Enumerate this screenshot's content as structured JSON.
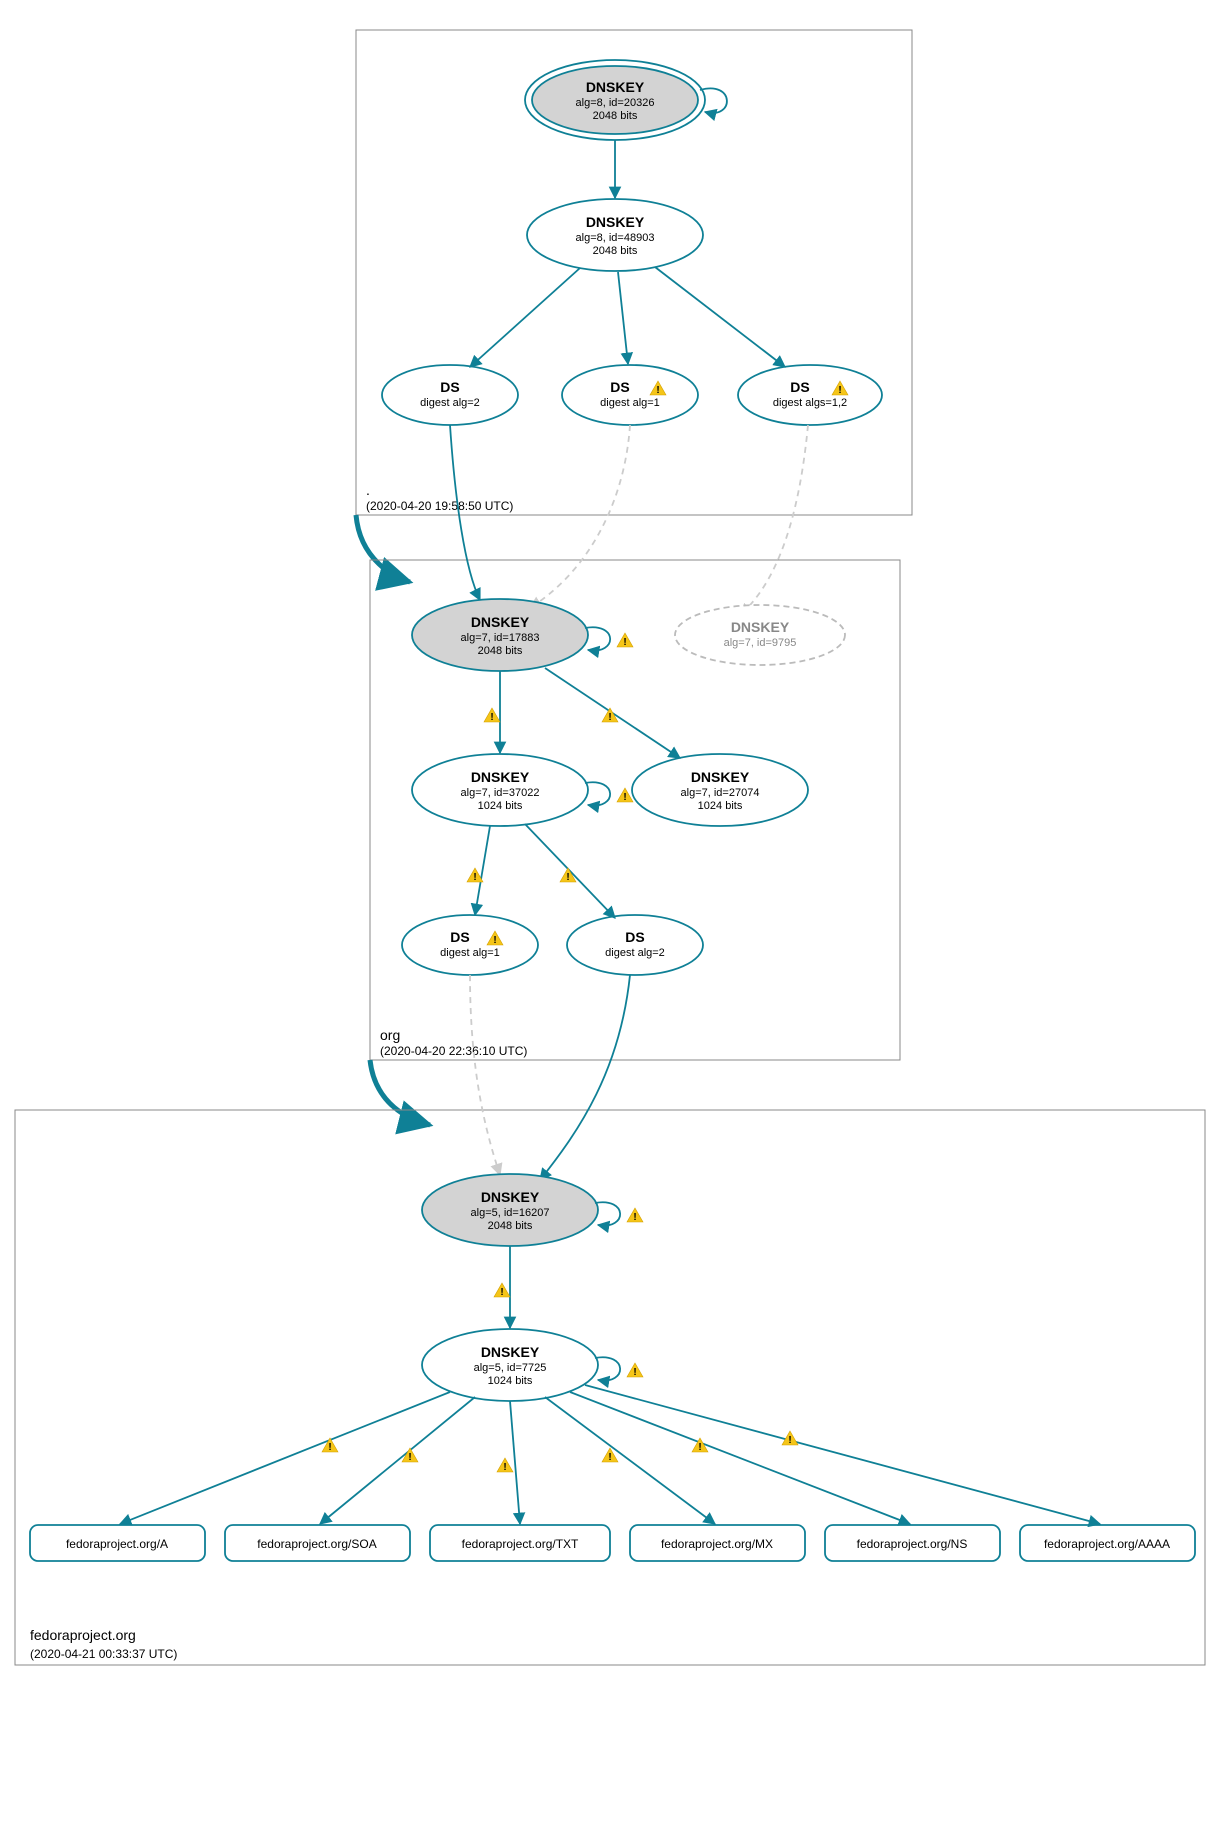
{
  "zones": {
    "root": {
      "name": ".",
      "timestamp": "(2020-04-20 19:58:50 UTC)"
    },
    "org": {
      "name": "org",
      "timestamp": "(2020-04-20 22:36:10 UTC)"
    },
    "fedora": {
      "name": "fedoraproject.org",
      "timestamp": "(2020-04-21 00:33:37 UTC)"
    }
  },
  "nodes": {
    "root_ksk": {
      "title": "DNSKEY",
      "line2": "alg=8, id=20326",
      "line3": "2048 bits"
    },
    "root_zsk": {
      "title": "DNSKEY",
      "line2": "alg=8, id=48903",
      "line3": "2048 bits"
    },
    "root_ds1": {
      "title": "DS",
      "line2": "digest alg=2"
    },
    "root_ds2": {
      "title": "DS",
      "line2": "digest alg=1"
    },
    "root_ds3": {
      "title": "DS",
      "line2": "digest algs=1,2"
    },
    "org_ksk": {
      "title": "DNSKEY",
      "line2": "alg=7, id=17883",
      "line3": "2048 bits"
    },
    "org_dashed": {
      "title": "DNSKEY",
      "line2": "alg=7, id=9795"
    },
    "org_zsk1": {
      "title": "DNSKEY",
      "line2": "alg=7, id=37022",
      "line3": "1024 bits"
    },
    "org_zsk2": {
      "title": "DNSKEY",
      "line2": "alg=7, id=27074",
      "line3": "1024 bits"
    },
    "org_ds1": {
      "title": "DS",
      "line2": "digest alg=1"
    },
    "org_ds2": {
      "title": "DS",
      "line2": "digest alg=2"
    },
    "fed_ksk": {
      "title": "DNSKEY",
      "line2": "alg=5, id=16207",
      "line3": "2048 bits"
    },
    "fed_zsk": {
      "title": "DNSKEY",
      "line2": "alg=5, id=7725",
      "line3": "1024 bits"
    }
  },
  "rr": {
    "a": "fedoraproject.org/A",
    "soa": "fedoraproject.org/SOA",
    "txt": "fedoraproject.org/TXT",
    "mx": "fedoraproject.org/MX",
    "ns": "fedoraproject.org/NS",
    "aaaa": "fedoraproject.org/AAAA"
  }
}
